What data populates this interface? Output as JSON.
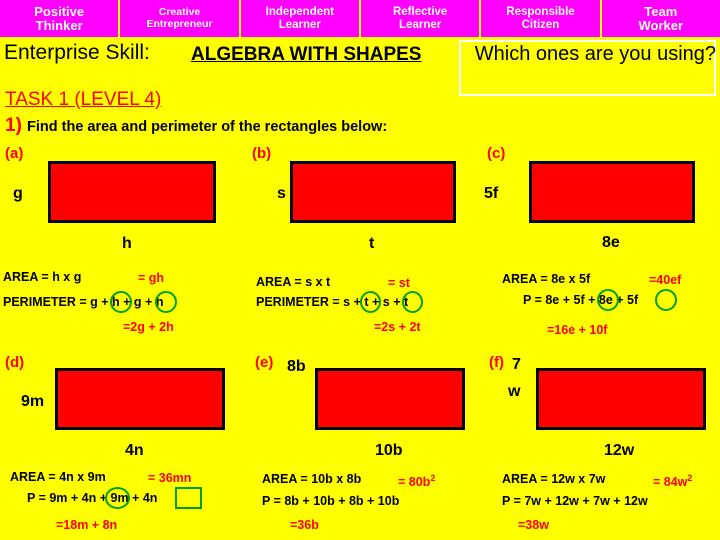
{
  "banner": {
    "items": [
      {
        "line1": "Positive",
        "line2": "Thinker"
      },
      {
        "line1": "Creative",
        "line2": "Entrepreneur"
      },
      {
        "line1": "Independent",
        "line2": "Learner"
      },
      {
        "line1": "Reflective",
        "line2": "Learner"
      },
      {
        "line1": "Responsible",
        "line2": "Citizen"
      },
      {
        "line1": "Team",
        "line2": "Worker"
      }
    ]
  },
  "header": {
    "enterprise_skill": "Enterprise Skill:",
    "topic": "ALGEBRA WITH SHAPES",
    "which_ones": "Which ones are you using?",
    "task": "TASK 1 (LEVEL 4)",
    "question_number": "1)",
    "question_text": "Find the area and perimeter of the rectangles below:"
  },
  "parts": {
    "a": {
      "label": "(a)",
      "left_side": "g",
      "bottom_side": "h",
      "area_line": "AREA = h x g",
      "area_result": "= gh",
      "perimeter_line": "PERIMETER = g + h + g + h",
      "perimeter_result": "=2g + 2h"
    },
    "b": {
      "label": "(b)",
      "left_side": "s",
      "bottom_side": "t",
      "area_line": "AREA = s x t",
      "area_result": "= st",
      "perimeter_line": "PERIMETER = s + t + s + t",
      "perimeter_result": "=2s + 2t"
    },
    "c": {
      "label": "(c)",
      "left_side": "5f",
      "bottom_side": "8e",
      "area_line": "AREA = 8e x 5f",
      "area_result": "=40ef",
      "perimeter_line": "P = 8e + 5f + 8e + 5f",
      "perimeter_result": "=16e + 10f"
    },
    "d": {
      "label": "(d)",
      "left_side": "9m",
      "bottom_side": "4n",
      "area_line": "AREA = 4n x 9m",
      "area_result": "= 36mn",
      "perimeter_line": "P = 9m + 4n + 9m + 4n",
      "perimeter_result": "=18m + 8n"
    },
    "e": {
      "label": "(e)",
      "left_side": "8b",
      "bottom_side": "10b",
      "area_line": "AREA = 10b x 8b",
      "area_result": "= 80b",
      "area_result_sup": "2",
      "perimeter_line": "P = 8b + 10b + 8b + 10b",
      "perimeter_result": "=36b"
    },
    "f": {
      "label": "(f)",
      "left_side": "7w",
      "bottom_side": "12w",
      "area_line": "AREA = 12w x 7w",
      "area_result": "= 84w",
      "area_result_sup": "2",
      "perimeter_line": "P = 7w + 12w + 7w + 12w",
      "perimeter_result": "=38w"
    }
  }
}
